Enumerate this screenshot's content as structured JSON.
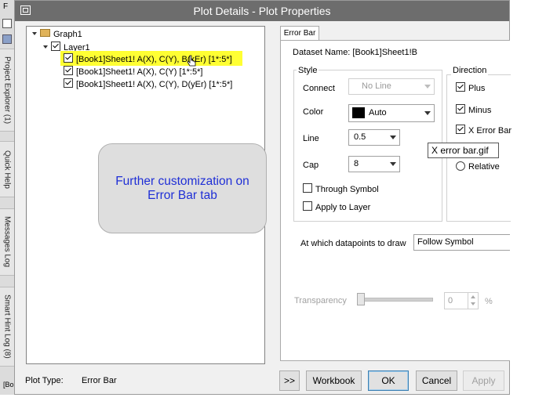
{
  "left_strip": {
    "tabs": [
      "Project Explorer (1)",
      "Quick Help",
      "Messages Log",
      "Smart Hint Log (8)"
    ],
    "bottom_text": "[Bo"
  },
  "dialog": {
    "title": "Plot Details - Plot Properties"
  },
  "tree": {
    "graph": "Graph1",
    "layer": "Layer1",
    "plots": [
      {
        "label": "[Book1]Sheet1! A(X), C(Y), B(xEr) [1*:5*]",
        "checked": true,
        "selected": true
      },
      {
        "label": "[Book1]Sheet1! A(X), C(Y) [1*:5*]",
        "checked": true,
        "selected": false
      },
      {
        "label": "[Book1]Sheet1! A(X), C(Y), D(yEr) [1*:5*]",
        "checked": true,
        "selected": false
      }
    ]
  },
  "callout": {
    "line1": "Further customization on",
    "line2": "Error Bar tab"
  },
  "tab": {
    "label": "Error Bar"
  },
  "errorbar": {
    "dataset_label": "Dataset Name: [Book1]Sheet1!B",
    "style_group": "Style",
    "connect_label": "Connect",
    "connect_value": "No Line",
    "color_label": "Color",
    "color_value": "Auto",
    "color_swatch": "#000000",
    "line_label": "Line",
    "line_value": "0.5",
    "cap_label": "Cap",
    "cap_value": "8",
    "through_symbol": "Through Symbol",
    "apply_to_layer": "Apply to Layer",
    "direction_group": "Direction",
    "plus": "Plus",
    "minus": "Minus",
    "x_error_bar": "X Error Bar",
    "relative": "Relative",
    "tooltip": "X error bar.gif",
    "datapoints_label": "At which datapoints to draw",
    "datapoints_value": "Follow Symbol",
    "transparency_label": "Transparency",
    "transparency_value": "0",
    "transparency_unit": "%"
  },
  "bottom": {
    "plot_type_label": "Plot Type:",
    "plot_type_value": "Error Bar",
    "expand_button": ">>",
    "workbook_button": "Workbook",
    "ok_button": "OK",
    "cancel_button": "Cancel",
    "apply_button": "Apply"
  },
  "colors": {
    "title_bar": "#6d6d6d",
    "highlight": "#ffff33",
    "callout_text": "#1f2fd6"
  }
}
